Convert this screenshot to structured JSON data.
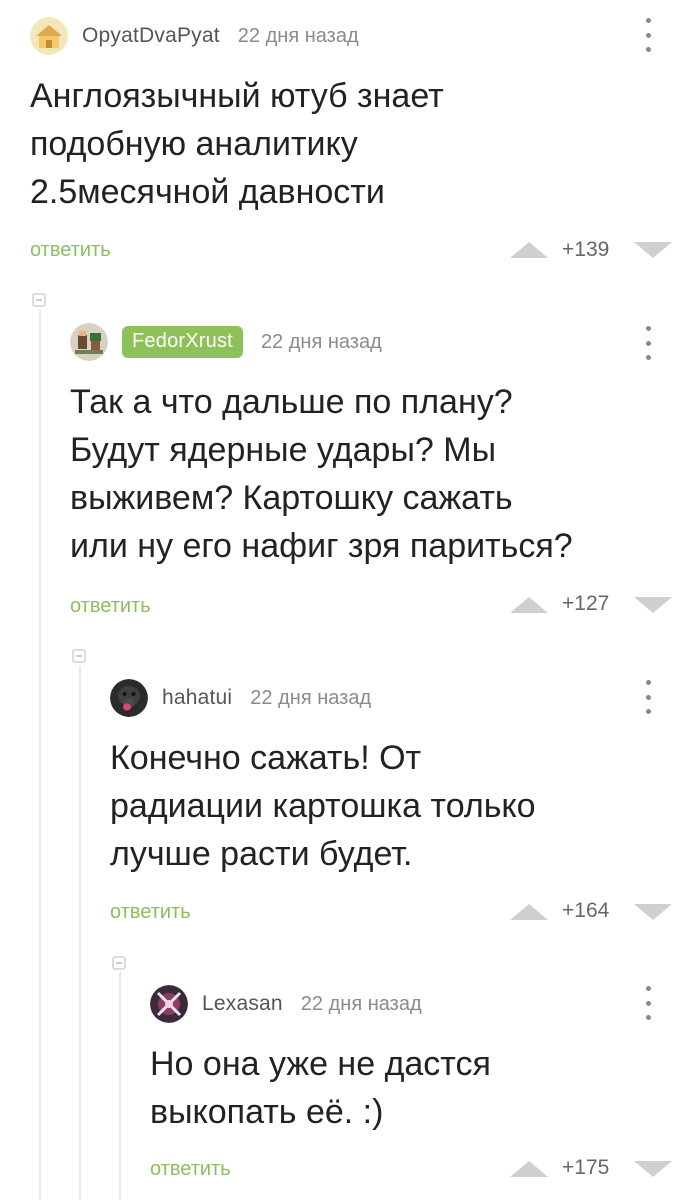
{
  "comments": [
    {
      "user": "OpyatDvaPyat",
      "date": "22 дня назад",
      "text": "Англоязычный ютуб знает\nподобную аналитику\n2.5месячной давности",
      "reply_label": "ответить",
      "score": "+139",
      "avatar_icon": "house-icon"
    },
    {
      "user": "FedorXrust",
      "date": "22 дня назад",
      "text": "Так а что дальше по плану?\nБудут ядерные удары? Мы\nвыживем? Картошку сажать\nили ну его нафиг зря париться?",
      "reply_label": "ответить",
      "score": "+127",
      "avatar_icon": "pixel-character-icon",
      "badge_color": "#8ec15a"
    },
    {
      "user": "hahatui",
      "date": "22 дня назад",
      "text": "Конечно сажать! От\nрадиации картошка только\nлучше расти будет.",
      "reply_label": "ответить",
      "score": "+164",
      "avatar_icon": "gorilla-icon"
    },
    {
      "user": "Lexasan",
      "date": "22 дня назад",
      "text": "Но она уже не дастся\nвыкопать её. :)",
      "reply_label": "ответить",
      "score": "+175",
      "avatar_icon": "crossed-swords-icon"
    }
  ],
  "colors": {
    "accent_green": "#8bbf5d",
    "badge_green": "#8ec15a",
    "vote_gray": "#cfcfcf"
  }
}
